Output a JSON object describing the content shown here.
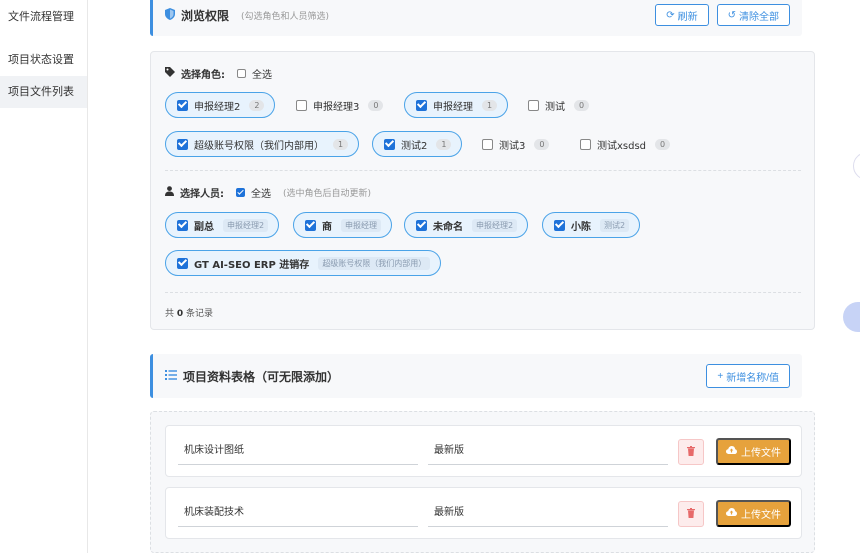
{
  "sidebar": {
    "items": [
      {
        "label": "文件流程管理"
      },
      {
        "label": "项目状态设置"
      },
      {
        "label": "项目文件列表"
      }
    ]
  },
  "permission": {
    "title": "浏览权限",
    "hint": "(勾选角色和人员筛选)",
    "refresh_label": "刷新",
    "clear_label": "清除全部",
    "role_label": "选择角色:",
    "role_select_all": "全选",
    "roles": [
      {
        "name": "申报经理2",
        "count": "2",
        "checked": true
      },
      {
        "name": "申报经理3",
        "count": "0",
        "checked": false
      },
      {
        "name": "申报经理",
        "count": "1",
        "checked": true
      },
      {
        "name": "测试",
        "count": "0",
        "checked": false
      },
      {
        "name": "超级账号权限（我们内部用）",
        "count": "1",
        "checked": true
      },
      {
        "name": "测试2",
        "count": "1",
        "checked": true
      },
      {
        "name": "测试3",
        "count": "0",
        "checked": false
      },
      {
        "name": "测试xsdsd",
        "count": "0",
        "checked": false
      }
    ],
    "person_label": "选择人员:",
    "person_select_all": "全选",
    "person_hint": "(选中角色后自动更新)",
    "persons": [
      {
        "name": "副总",
        "role": "申报经理2",
        "checked": true
      },
      {
        "name": "商",
        "role": "申报经理",
        "checked": true
      },
      {
        "name": "未命名",
        "role": "申报经理2",
        "checked": true
      },
      {
        "name": "小陈",
        "role": "测试2",
        "checked": true
      },
      {
        "name": "GT AI-SEO ERP 进销存",
        "role": "超级账号权限（我们内部用）",
        "checked": true
      }
    ],
    "total_prefix": "共",
    "total_count": "0",
    "total_suffix": "条记录"
  },
  "materials": {
    "title": "项目资料表格（可无限添加）",
    "add_label": "新增名称/值",
    "rows": [
      {
        "name": "机床设计图纸",
        "value": "最新版",
        "upload_label": "上传文件"
      },
      {
        "name": "机床装配技术",
        "value": "最新版",
        "upload_label": "上传文件"
      }
    ]
  },
  "colors": {
    "accent": "#3d8fe0",
    "checkbox": "#1e72d9",
    "upload": "#e6a23c",
    "delete": "#e76a6a"
  },
  "icons": {
    "permission": "shield-icon",
    "refresh": "refresh-icon",
    "clear": "undo-icon",
    "role": "tag-icon",
    "person": "user-icon",
    "list": "list-icon",
    "add": "plus-icon",
    "delete": "trash-icon",
    "upload": "cloud-upload-icon"
  }
}
